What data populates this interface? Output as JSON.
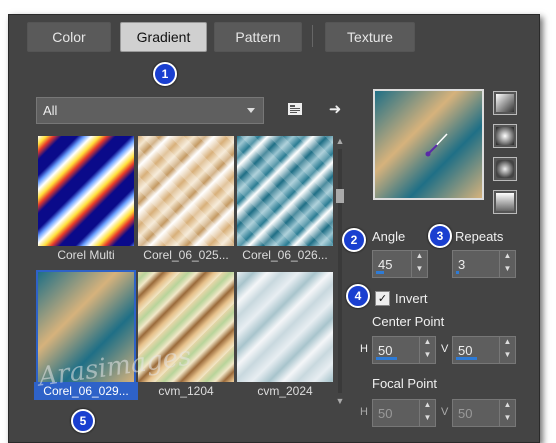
{
  "tabs": [
    {
      "label": "Color"
    },
    {
      "label": "Gradient",
      "active": true
    },
    {
      "label": "Pattern"
    },
    {
      "label": "Texture"
    }
  ],
  "badges": [
    "1",
    "2",
    "3",
    "4",
    "5"
  ],
  "filter": {
    "value": "All"
  },
  "gradients": [
    {
      "label": "Corel Multi"
    },
    {
      "label": "Corel_06_025..."
    },
    {
      "label": "Corel_06_026..."
    },
    {
      "label": "Corel_06_029...",
      "selected": true
    },
    {
      "label": "cvm_1204"
    },
    {
      "label": "cvm_2024"
    }
  ],
  "angle": {
    "label": "Angle",
    "value": "45"
  },
  "repeats": {
    "label": "Repeats",
    "value": "3"
  },
  "invert": {
    "label": "Invert",
    "checked": true
  },
  "center_point": {
    "label": "Center Point",
    "h_label": "H",
    "h_value": "50",
    "v_label": "V",
    "v_value": "50"
  },
  "focal_point": {
    "label": "Focal Point",
    "h_label": "H",
    "h_value": "50",
    "v_label": "V",
    "v_value": "50"
  },
  "watermark": "Arasimages",
  "colors": {
    "accent": "#2e62c8",
    "badge": "#1a3fd0",
    "panel": "#444444"
  }
}
